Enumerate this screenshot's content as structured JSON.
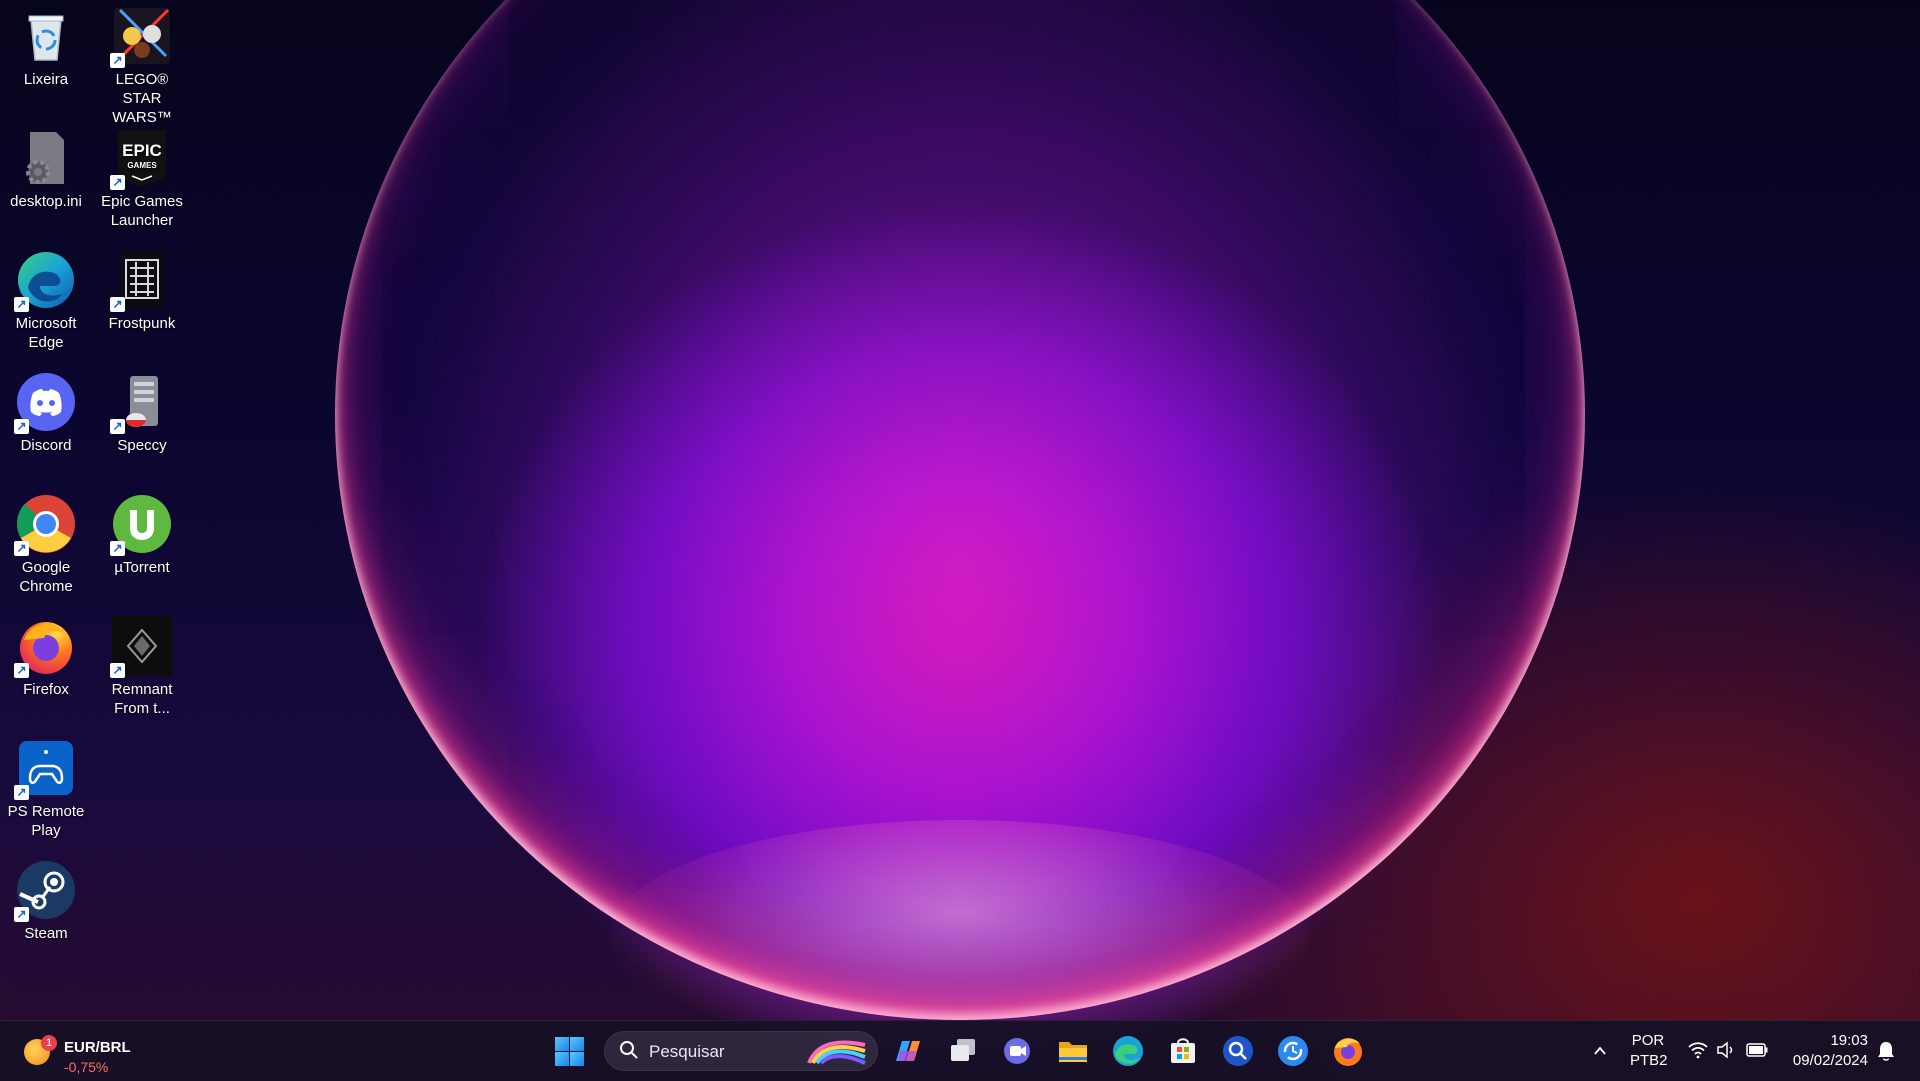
{
  "desktop": {
    "icons": [
      {
        "label": "Lixeira",
        "icon": "recycle-bin-icon"
      },
      {
        "label": "LEGO® STAR WARS™ Th...",
        "icon": "lego-star-wars-icon"
      },
      {
        "label": "desktop.ini",
        "icon": "settings-file-icon"
      },
      {
        "label": "Epic Games Launcher",
        "icon": "epic-games-icon"
      },
      {
        "label": "Microsoft Edge",
        "icon": "edge-icon"
      },
      {
        "label": "Frostpunk",
        "icon": "frostpunk-icon"
      },
      {
        "label": "Discord",
        "icon": "discord-icon"
      },
      {
        "label": "Speccy",
        "icon": "speccy-icon"
      },
      {
        "label": "Google Chrome",
        "icon": "chrome-icon"
      },
      {
        "label": "µTorrent",
        "icon": "utorrent-icon"
      },
      {
        "label": "Firefox",
        "icon": "firefox-icon"
      },
      {
        "label": "Remnant From t...",
        "icon": "remnant-icon"
      },
      {
        "label": "PS Remote Play",
        "icon": "ps-remote-play-icon"
      },
      {
        "label": "Steam",
        "icon": "steam-icon"
      }
    ],
    "epic_logo_text": "EPIC",
    "epic_logo_sub": "GAMES"
  },
  "taskbar": {
    "widget": {
      "title": "EUR/BRL",
      "change": "-0,75%",
      "badge": "1"
    },
    "search": {
      "placeholder": "Pesquisar"
    },
    "pinned": [
      {
        "name": "copilot",
        "icon": "copilot-icon"
      },
      {
        "name": "task-view",
        "icon": "task-view-icon"
      },
      {
        "name": "teams-chat",
        "icon": "teams-chat-icon"
      },
      {
        "name": "file-explorer",
        "icon": "folder-icon"
      },
      {
        "name": "edge",
        "icon": "edge-icon"
      },
      {
        "name": "microsoft-store",
        "icon": "store-icon"
      },
      {
        "name": "app-blue-1",
        "icon": "search-app-icon"
      },
      {
        "name": "app-blue-2",
        "icon": "sync-app-icon"
      },
      {
        "name": "firefox",
        "icon": "firefox-icon"
      }
    ],
    "tray": {
      "lang_line1": "POR",
      "lang_line2": "PTB2",
      "time": "19:03",
      "date": "09/02/2024"
    }
  },
  "colors": {
    "accent": "#1584e8",
    "negative": "#ff6b6b",
    "taskbar_bg": "#161026"
  }
}
